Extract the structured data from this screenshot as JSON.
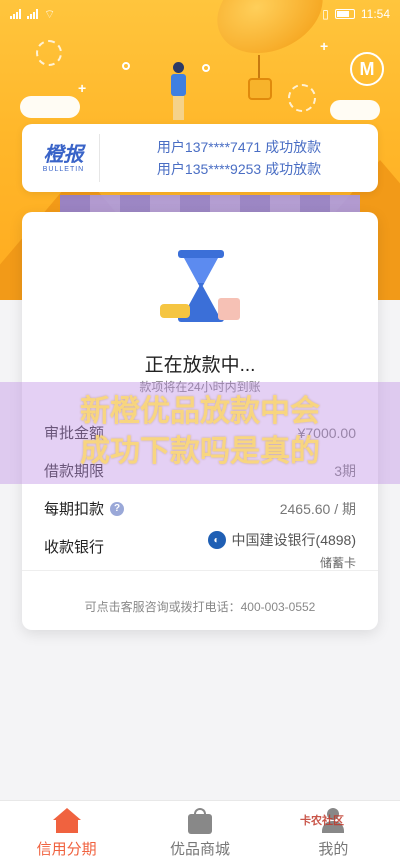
{
  "status_bar": {
    "time": "11:54"
  },
  "bulletin": {
    "logo_cn": "橙报",
    "logo_en": "BULLETIN",
    "lines": [
      "用户137****7471 成功放款",
      "用户135****9253 成功放款"
    ]
  },
  "status": {
    "title": "正在放款中...",
    "subtitle": "款项将在24小时内到账"
  },
  "details": {
    "amount_label": "审批金额",
    "amount_value": "¥7000.00",
    "term_label": "借款期限",
    "term_value": "3期",
    "installment_label": "每期扣款",
    "installment_value": "2465.60 / 期",
    "bank_label": "收款银行",
    "bank_name": "中国建设银行(4898)",
    "bank_card_type": "储蓄卡"
  },
  "footer_note": "可点击客服咨询或拨打电话：400-003-0552",
  "watermark": {
    "line1": "新橙优品放款中会",
    "line2": "成功下款吗是真的"
  },
  "tabs": [
    {
      "label": "信用分期",
      "icon": "home-icon",
      "active": true
    },
    {
      "label": "优品商城",
      "icon": "shopping-bag-icon",
      "active": false
    },
    {
      "label": "我的",
      "icon": "profile-icon",
      "active": false
    }
  ],
  "brand_mark": "卡农社区",
  "colors": {
    "accent": "#f0623f",
    "primary_blue": "#3a64c8",
    "hero_yellow": "#ffb72a"
  }
}
